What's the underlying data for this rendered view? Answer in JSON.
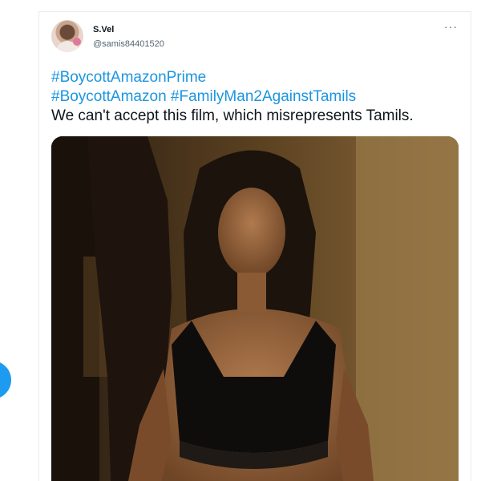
{
  "tweet": {
    "author": {
      "display_name": "S.Vel",
      "handle": "@samis84401520"
    },
    "more_label": "···",
    "text": {
      "line1": [
        "#BoycottAmazonPrime"
      ],
      "line2": [
        "#BoycottAmazon",
        " ",
        "#FamilyMan2AgainstTamils"
      ],
      "line3": "We can't accept this film, which misrepresents Tamils."
    }
  },
  "colors": {
    "hashtag": "#1b95e0",
    "fab": "#1d9bf0",
    "text": "#0f1419",
    "secondary": "#536471"
  }
}
